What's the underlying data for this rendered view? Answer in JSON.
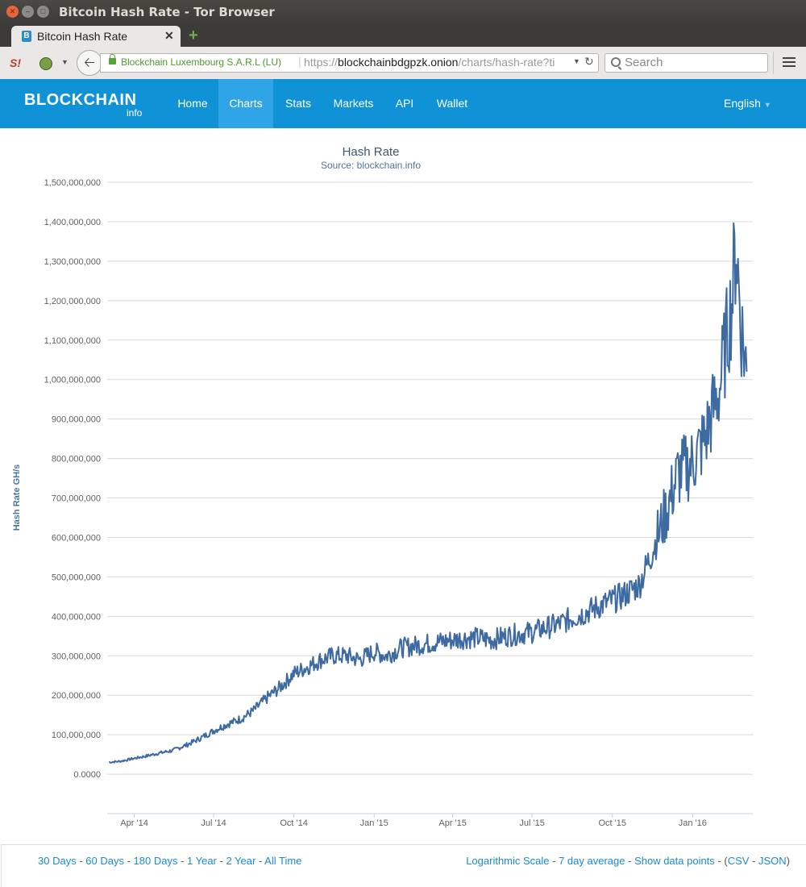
{
  "window": {
    "title": "Bitcoin Hash Rate - Tor Browser"
  },
  "tab": {
    "title": "Bitcoin Hash Rate"
  },
  "toolbar": {
    "identity": "Blockchain Luxembourg S.A.R.L (LU)",
    "url_prefix": "https://",
    "url_domain": "blockchainbdgpzk.onion",
    "url_path": "/charts/hash-rate?ti",
    "search_placeholder": "Search"
  },
  "site": {
    "logo": "BLOCKCHAIN",
    "logo_sub": "info",
    "nav": [
      {
        "label": "Home",
        "active": false
      },
      {
        "label": "Charts",
        "active": true
      },
      {
        "label": "Stats",
        "active": false
      },
      {
        "label": "Markets",
        "active": false
      },
      {
        "label": "API",
        "active": false
      },
      {
        "label": "Wallet",
        "active": false
      }
    ],
    "language": "English",
    "brand_color": "#1092d6"
  },
  "footer": {
    "ranges": [
      "30 Days",
      "60 Days",
      "180 Days",
      "1 Year",
      "2 Year",
      "All Time"
    ],
    "options": [
      "Logarithmic Scale",
      "7 day average",
      "Show data points"
    ],
    "formats": [
      "CSV",
      "JSON"
    ],
    "link_color": "#1a8ad3"
  },
  "chart_data": {
    "type": "line",
    "title": "Hash Rate",
    "subtitle": "Source: blockchain.info",
    "ylabel": "Hash Rate GH/s",
    "xlabel": "",
    "ylim": [
      -100000000,
      1500000000
    ],
    "y_ticks": [
      "1,500,000,000",
      "1,400,000,000",
      "1,300,000,000",
      "1,200,000,000",
      "1,100,000,000",
      "1,000,000,000",
      "900,000,000",
      "800,000,000",
      "700,000,000",
      "600,000,000",
      "500,000,000",
      "400,000,000",
      "300,000,000",
      "200,000,000",
      "100,000,000",
      "0.0000"
    ],
    "x_ticks": [
      "Apr '14",
      "Jul '14",
      "Oct '14",
      "Jan '15",
      "Apr '15",
      "Jul '15",
      "Oct '15",
      "Jan '16"
    ],
    "grid": true,
    "line_color": "#3d6aa1",
    "series": [
      {
        "values": [
          [
            "2014-03-03",
            30000000
          ],
          [
            "2014-03-17",
            33000000
          ],
          [
            "2014-04-01",
            40000000
          ],
          [
            "2014-04-15",
            46000000
          ],
          [
            "2014-05-01",
            54000000
          ],
          [
            "2014-05-15",
            60000000
          ],
          [
            "2014-06-01",
            75000000
          ],
          [
            "2014-06-15",
            90000000
          ],
          [
            "2014-07-01",
            110000000
          ],
          [
            "2014-07-15",
            125000000
          ],
          [
            "2014-08-01",
            140000000
          ],
          [
            "2014-08-15",
            160000000
          ],
          [
            "2014-09-01",
            195000000
          ],
          [
            "2014-09-15",
            220000000
          ],
          [
            "2014-10-01",
            255000000
          ],
          [
            "2014-10-15",
            270000000
          ],
          [
            "2014-11-01",
            290000000
          ],
          [
            "2014-11-15",
            300000000
          ],
          [
            "2014-12-01",
            300000000
          ],
          [
            "2014-12-15",
            290000000
          ],
          [
            "2015-01-01",
            310000000
          ],
          [
            "2015-01-15",
            300000000
          ],
          [
            "2015-02-01",
            320000000
          ],
          [
            "2015-02-15",
            325000000
          ],
          [
            "2015-03-01",
            330000000
          ],
          [
            "2015-03-15",
            335000000
          ],
          [
            "2015-04-01",
            340000000
          ],
          [
            "2015-04-15",
            345000000
          ],
          [
            "2015-05-01",
            345000000
          ],
          [
            "2015-05-15",
            340000000
          ],
          [
            "2015-06-01",
            350000000
          ],
          [
            "2015-06-15",
            355000000
          ],
          [
            "2015-07-01",
            360000000
          ],
          [
            "2015-07-15",
            370000000
          ],
          [
            "2015-08-01",
            380000000
          ],
          [
            "2015-08-15",
            395000000
          ],
          [
            "2015-09-01",
            410000000
          ],
          [
            "2015-09-15",
            425000000
          ],
          [
            "2015-10-01",
            440000000
          ],
          [
            "2015-10-15",
            455000000
          ],
          [
            "2015-11-01",
            480000000
          ],
          [
            "2015-11-15",
            560000000
          ],
          [
            "2015-12-01",
            660000000
          ],
          [
            "2015-12-15",
            760000000
          ],
          [
            "2016-01-01",
            790000000
          ],
          [
            "2016-01-15",
            850000000
          ],
          [
            "2016-02-01",
            980000000
          ],
          [
            "2016-02-15",
            1200000000
          ],
          [
            "2016-02-20",
            1350000000
          ],
          [
            "2016-02-25",
            1150000000
          ],
          [
            "2016-03-03",
            1020000000
          ]
        ]
      }
    ]
  }
}
